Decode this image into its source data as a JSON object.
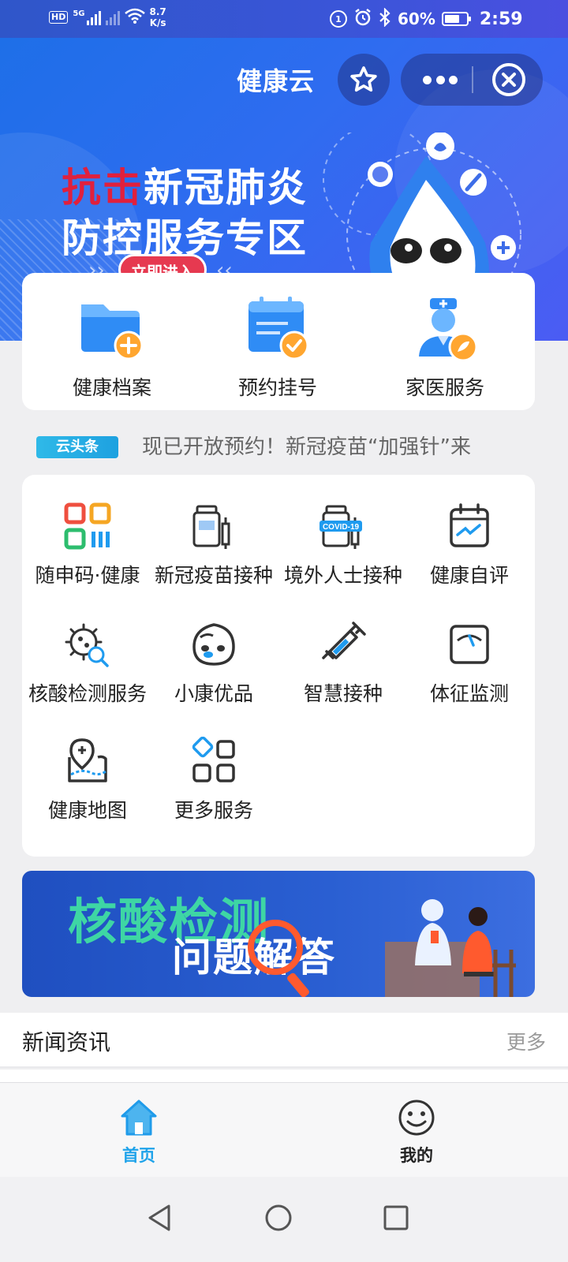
{
  "status_bar": {
    "hd": "HD",
    "signal1": "5G",
    "net_speed_value": "8.7",
    "net_speed_unit": "K/s",
    "battery": "60%",
    "time": "2:59",
    "icons": [
      "hd-icon",
      "signal-5g-icon",
      "signal-icon",
      "wifi-icon",
      "data-saver-icon",
      "alarm-icon",
      "bluetooth-icon",
      "battery-icon"
    ]
  },
  "nav": {
    "title": "健康云"
  },
  "banner": {
    "line1_red": "抗击",
    "line1_rest": "新冠肺炎",
    "line2": "防控服务专区",
    "button": "立即进入"
  },
  "quick": [
    {
      "label": "健康档案",
      "icon": "folder-plus-icon"
    },
    {
      "label": "预约挂号",
      "icon": "calendar-check-icon"
    },
    {
      "label": "家医服务",
      "icon": "doctor-icon"
    }
  ],
  "ticker": {
    "badge": "云头条",
    "text": "现已开放预约！新冠疫苗“加强针”来"
  },
  "services": [
    {
      "label": "随申码·健康",
      "icon": "qr-code-icon"
    },
    {
      "label": "新冠疫苗接种",
      "icon": "vaccine-vial-icon"
    },
    {
      "label": "境外人士接种",
      "icon": "covid19-vial-icon"
    },
    {
      "label": "健康自评",
      "icon": "calendar-chart-icon"
    },
    {
      "label": "核酸检测服务",
      "icon": "virus-search-icon"
    },
    {
      "label": "小康优品",
      "icon": "mascot-face-icon"
    },
    {
      "label": "智慧接种",
      "icon": "syringe-icon"
    },
    {
      "label": "体征监测",
      "icon": "gauge-icon"
    },
    {
      "label": "健康地图",
      "icon": "map-pin-icon"
    },
    {
      "label": "更多服务",
      "icon": "more-grid-icon"
    }
  ],
  "covid_badge": "COVID-19",
  "ad2": {
    "title": "核酸检测",
    "subtitle": "问题解答"
  },
  "news": {
    "title": "新闻资讯",
    "more": "更多"
  },
  "tabbar": {
    "home": "首页",
    "mine": "我的"
  },
  "colors": {
    "accent": "#1fa3ea",
    "banner": "#2f6cf0",
    "promo_red": "#e0203d",
    "ad_green": "#3ed6a4"
  }
}
